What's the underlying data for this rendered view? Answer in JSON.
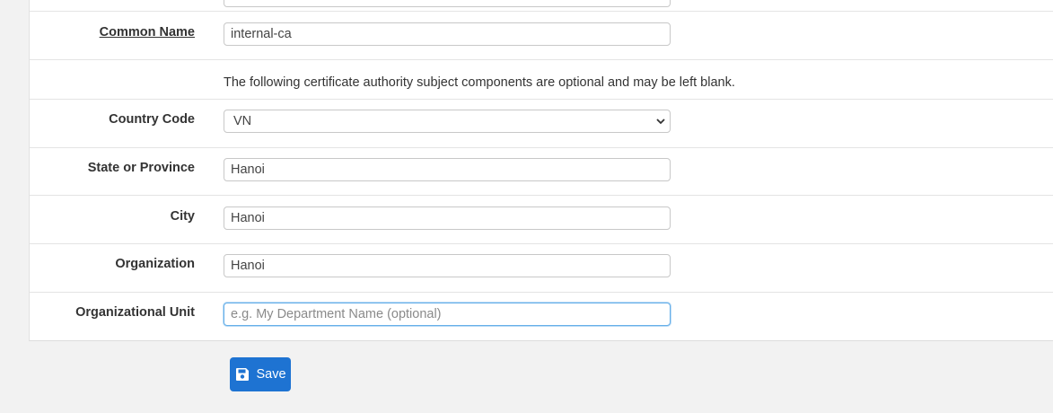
{
  "form": {
    "common_name": {
      "label": "Common Name",
      "value": "internal-ca"
    },
    "note": "The following certificate authority subject components are optional and may be left blank.",
    "country_code": {
      "label": "Country Code",
      "value": "VN"
    },
    "state": {
      "label": "State or Province",
      "value": "Hanoi"
    },
    "city": {
      "label": "City",
      "value": "Hanoi"
    },
    "organization": {
      "label": "Organization",
      "value": "Hanoi"
    },
    "org_unit": {
      "label": "Organizational Unit",
      "value": "",
      "placeholder": "e.g. My Department Name (optional)"
    }
  },
  "actions": {
    "save_label": "Save",
    "save_icon": "save-icon"
  },
  "colors": {
    "primary": "#1e73d2",
    "focus_border": "#66afe9",
    "background": "#f2f2f2"
  }
}
